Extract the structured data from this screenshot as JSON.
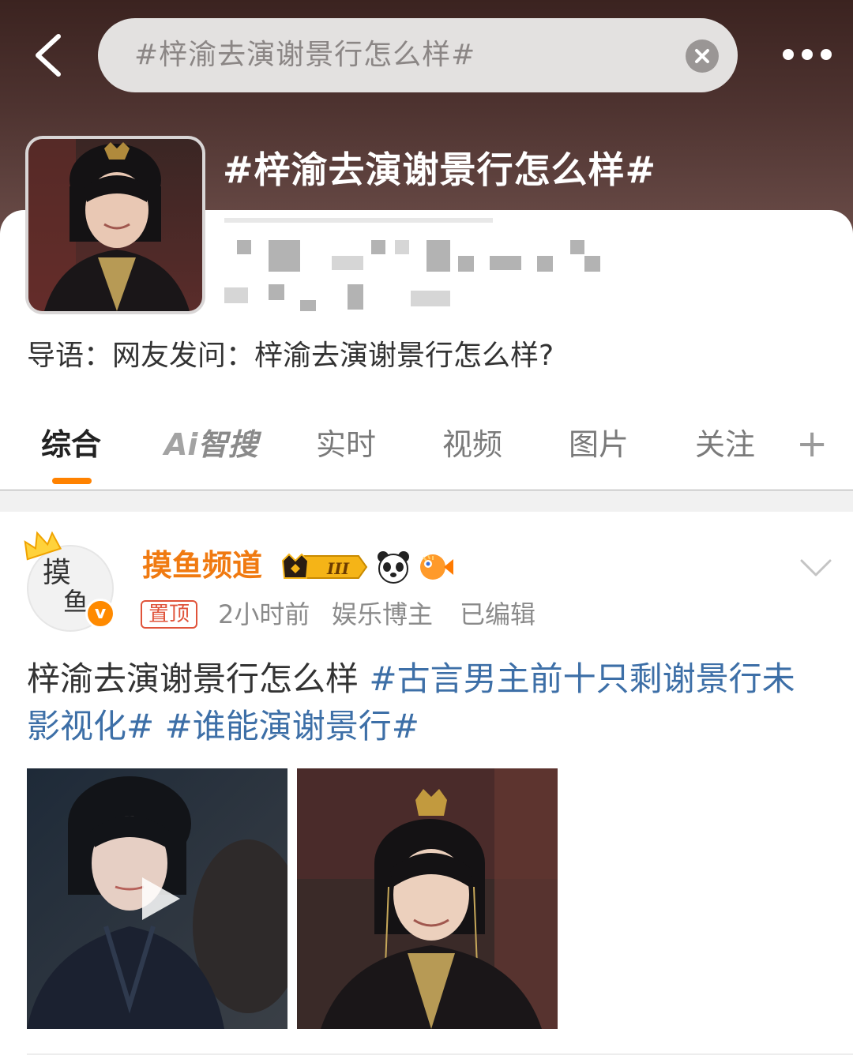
{
  "search": {
    "query": "#梓渝去演谢景行怎么样#"
  },
  "topic": {
    "title": "#梓渝去演谢景行怎么样#",
    "lead": "导语：网友发问：梓渝去演谢景行怎么样?"
  },
  "tabs": [
    {
      "label": "综合",
      "active": true
    },
    {
      "label": "智搜",
      "prefix": "Ai",
      "active": false
    },
    {
      "label": "实时",
      "active": false
    },
    {
      "label": "视频",
      "active": false
    },
    {
      "label": "图片",
      "active": false
    },
    {
      "label": "关注",
      "active": false
    },
    {
      "label": "+",
      "active": false
    }
  ],
  "post": {
    "username": "摸鱼频道",
    "vip_level": "III",
    "pin_label": "置顶",
    "time": "2小时前",
    "role": "娱乐博主",
    "edited": "已编辑",
    "text": "梓渝去演谢景行怎么样",
    "hashtag_1": "#古言男主前十只剩谢景行未影视化#",
    "hashtag_2": "#谁能演谢景行#",
    "media": [
      {
        "type": "video",
        "icon": "play-icon"
      },
      {
        "type": "image"
      }
    ]
  },
  "colors": {
    "accent": "#ff8200",
    "username": "#f07a11",
    "hashtag": "#3d6fa7",
    "pin": "#e0533a",
    "header_top": "#3b2320"
  }
}
